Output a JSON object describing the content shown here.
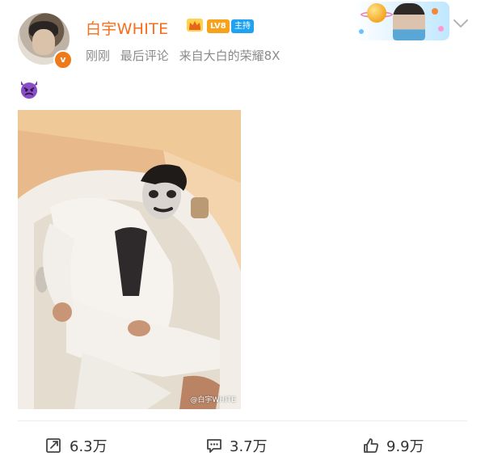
{
  "post": {
    "username": "白宇WHITE",
    "level_badge": "LV8",
    "host_badge": "主持",
    "verified_badge": "v",
    "meta": {
      "time": "刚刚",
      "last_comment": "最后评论",
      "source": "来自大白的荣耀8X"
    },
    "content_emoji": "devil-emoji-icon",
    "photo_watermark": "@白宇WHITE"
  },
  "actions": {
    "repost": "6.3万",
    "comment": "3.7万",
    "like": "9.9万"
  },
  "colors": {
    "username": "#f86e1c",
    "meta_text": "#8b8b8b",
    "level_badge": "#f7a21b",
    "host_badge": "#1fa3f0",
    "verified_badge": "#ee7a1a"
  },
  "icons": [
    "crown-icon",
    "chevron-down-icon",
    "devil-emoji-icon",
    "repost-icon",
    "comment-icon",
    "like-icon"
  ]
}
